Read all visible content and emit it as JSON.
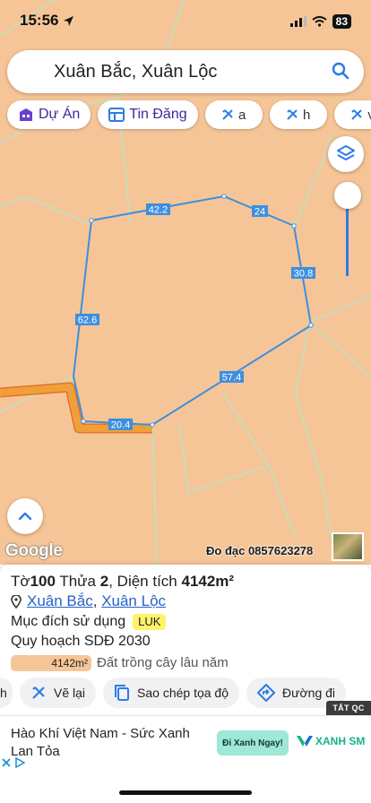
{
  "status": {
    "time": "15:56",
    "battery": "83"
  },
  "search": {
    "text": "Xuân Bắc, Xuân Lộc"
  },
  "chips": [
    {
      "label": "Dự Án",
      "icon": "building-icon"
    },
    {
      "label": "Tin Đăng",
      "icon": "listing-icon"
    },
    {
      "label": "a",
      "icon": "tool-icon"
    },
    {
      "label": "h",
      "icon": "tool-icon"
    },
    {
      "label": "v",
      "icon": "tool-icon"
    }
  ],
  "map": {
    "edge_labels": [
      "42.2",
      "24",
      "30.8",
      "57.4",
      "20.4",
      "62.6"
    ],
    "google_logo": "Google",
    "survey_credit": "Đo đạc 0857623278",
    "colors": {
      "land": "#f6c597",
      "parcel_line": "#3d8fe0",
      "road": "#f0a03a",
      "road_outline": "#e5712a",
      "boundary": "#b9e3c6"
    }
  },
  "panel": {
    "title_prefix": "Tờ ",
    "sheet": "100",
    "title_mid": " Thửa ",
    "parcel": "2",
    "title_area_label": ", Diện tích ",
    "area": "4142m²",
    "commune": "Xuân Bắc",
    "separator": ", ",
    "district": "Xuân Lộc",
    "purpose_label": "Mục đích sử dụng",
    "purpose_code": "LUK",
    "plan_label": "Quy hoạch SDĐ 2030",
    "legend_area": "4142m²",
    "legend_text": "Đất trồng cây lâu năm"
  },
  "actions": [
    {
      "label": "h"
    },
    {
      "label": "Vẽ lại",
      "icon": "redraw-icon"
    },
    {
      "label": "Sao chép tọa độ",
      "icon": "copy-icon"
    },
    {
      "label": "Đường đi",
      "icon": "directions-icon"
    }
  ],
  "ad": {
    "tag": "TẮT QC",
    "text": "Hào Khí Việt Nam - Sức Xanh Lan Tỏa",
    "cta": "Đi Xanh Ngay!",
    "brand": "XANH SM"
  }
}
